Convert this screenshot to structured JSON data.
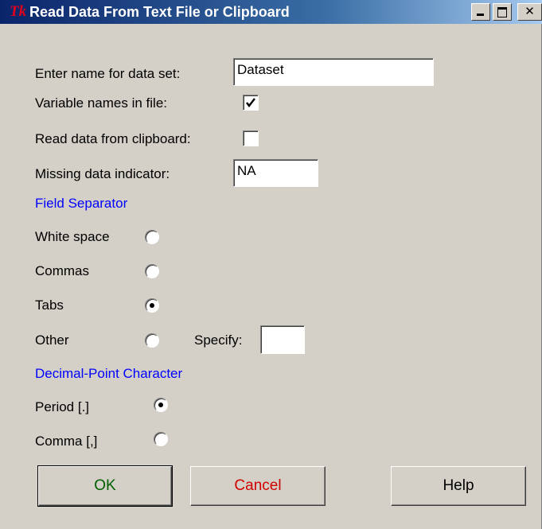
{
  "window": {
    "title": "Read Data From Text File or Clipboard",
    "icon": "Tk",
    "icon_color": "#e0001b"
  },
  "form": {
    "dataset_name_label": "Enter name for data set:",
    "dataset_name_value": "Dataset",
    "variable_names_label": "Variable names in file:",
    "variable_names_checked": true,
    "clipboard_label": "Read data from clipboard:",
    "clipboard_checked": false,
    "missing_label": "Missing data indicator:",
    "missing_value": "NA"
  },
  "field_separator": {
    "heading": "Field Separator",
    "options": [
      "White space",
      "Commas",
      "Tabs",
      "Other"
    ],
    "selected": "Tabs",
    "specify_label": "Specify:",
    "specify_value": ""
  },
  "decimal": {
    "heading": "Decimal-Point Character",
    "options": [
      "Period [.]",
      "Comma [,]"
    ],
    "selected": "Period [.]"
  },
  "buttons": {
    "ok": "OK",
    "cancel": "Cancel",
    "help": "Help"
  },
  "colors": {
    "section_heading": "#0000ff",
    "ok_text": "#006000",
    "cancel_text": "#d00000"
  }
}
